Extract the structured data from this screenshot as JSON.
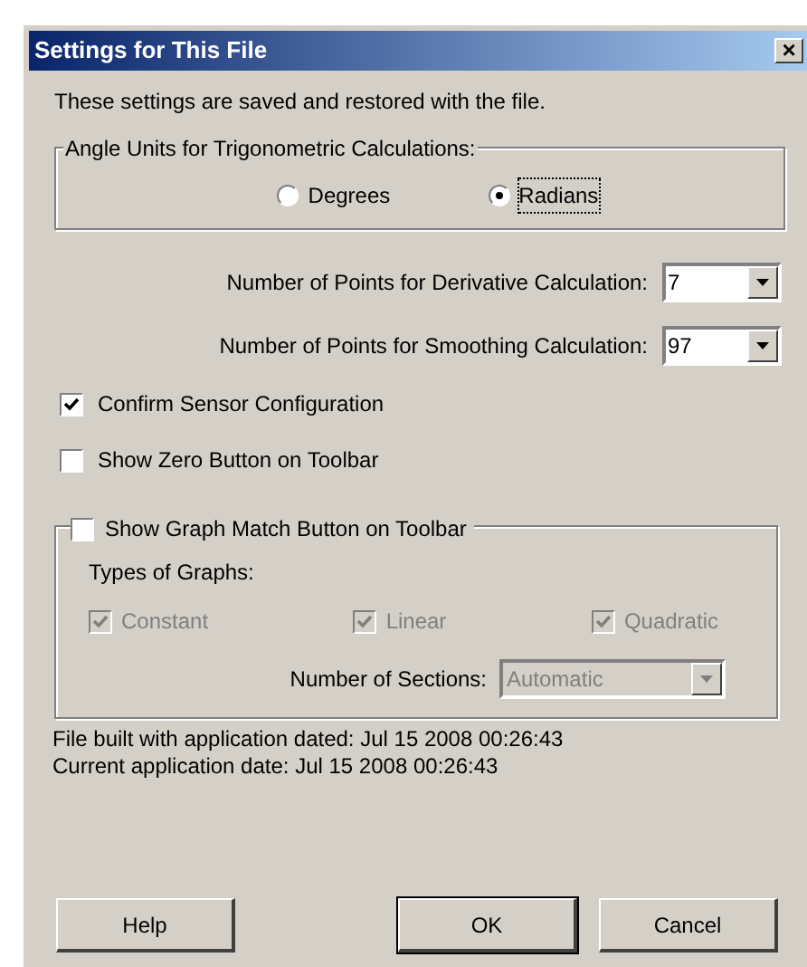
{
  "window": {
    "title": "Settings for This File",
    "close": "×"
  },
  "intro": "These settings are saved and restored with the file.",
  "angle_units": {
    "label": "Angle Units for Trigonometric Calculations:",
    "options": [
      {
        "label": "Degrees",
        "selected": false
      },
      {
        "label": "Radians",
        "selected": true
      }
    ]
  },
  "dropdowns": [
    {
      "label": "Number of Points for Derivative Calculation:",
      "value": "7"
    },
    {
      "label": "Number of Points for Smoothing Calculation:",
      "value": "97"
    }
  ],
  "checkboxes": [
    {
      "label": "Confirm Sensor Configuration",
      "checked": true
    },
    {
      "label": "Show Zero Button on Toolbar",
      "checked": false
    }
  ],
  "graph_match": {
    "label": "Show Graph Match Button on Toolbar",
    "checked": false,
    "types_label": "Types of Graphs:",
    "types": [
      {
        "label": "Constant",
        "checked": true,
        "disabled": true
      },
      {
        "label": "Linear",
        "checked": true,
        "disabled": true
      },
      {
        "label": "Quadratic",
        "checked": true,
        "disabled": true
      }
    ],
    "sections": {
      "label": "Number of Sections:",
      "value": "Automatic",
      "disabled": true
    }
  },
  "info": [
    "File built with application dated: Jul 15 2008 00:26:43",
    "Current application date: Jul 15 2008 00:26:43"
  ],
  "buttons": [
    {
      "label": "Help",
      "default": false
    },
    {
      "label": "OK",
      "default": true
    },
    {
      "label": "Cancel",
      "default": false
    }
  ]
}
